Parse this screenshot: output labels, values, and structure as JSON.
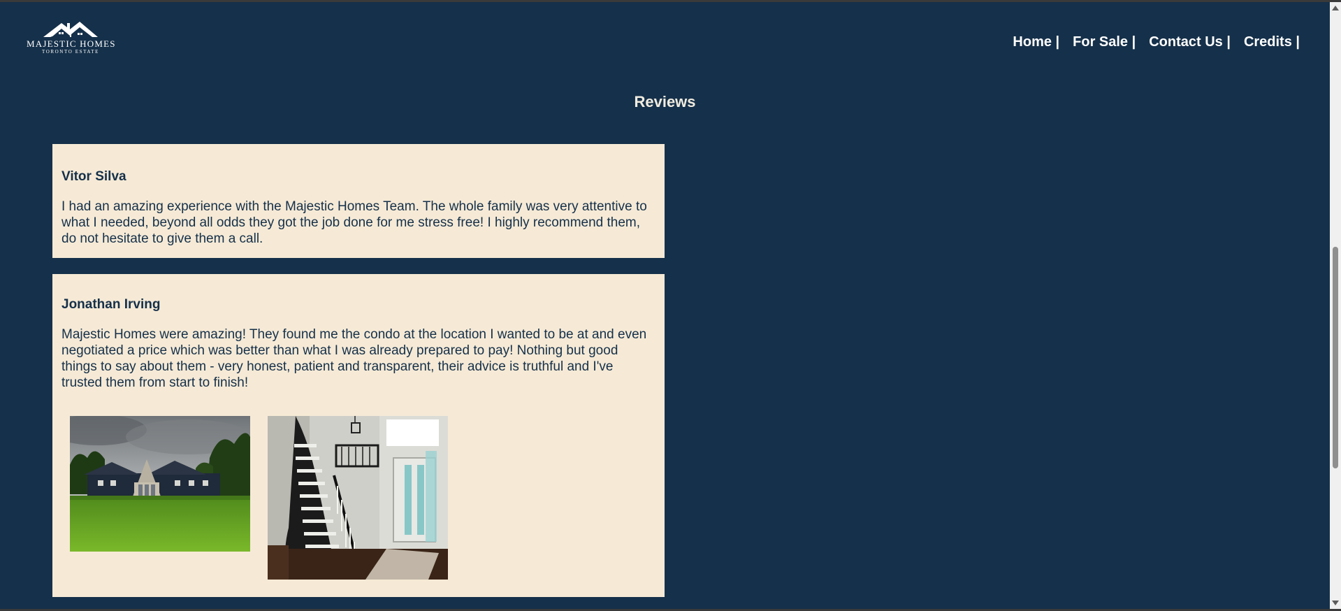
{
  "logo": {
    "title": "MAJESTIC HOMES",
    "subtitle": "TORONTO ESTATE",
    "icon": "house-roof-icon"
  },
  "nav": {
    "items": [
      {
        "label": "Home |"
      },
      {
        "label": "For Sale |"
      },
      {
        "label": "Contact Us |"
      },
      {
        "label": "Credits |"
      }
    ]
  },
  "page": {
    "title": "Reviews"
  },
  "reviews": [
    {
      "name": "Vitor Silva",
      "text": "I had an amazing experience with the Majestic Homes Team. The whole family was very attentive to what I needed, beyond all odds they got the job done for me stress free! I highly recommend them, do not hesitate to give them a call."
    },
    {
      "name": "Jonathan Irving",
      "text": "Majestic Homes were amazing! They found me the condo at the location I wanted to be at and even negotiated a price which was better than what I was already prepared to pay! Nothing but good things to say about them - very honest, patient and transparent, their advice is truthful and I've trusted them from start to finish!"
    }
  ],
  "colors": {
    "background": "#15304a",
    "card": "#f6ead6",
    "text_dark": "#15304a",
    "nav_text": "#ffffff"
  }
}
